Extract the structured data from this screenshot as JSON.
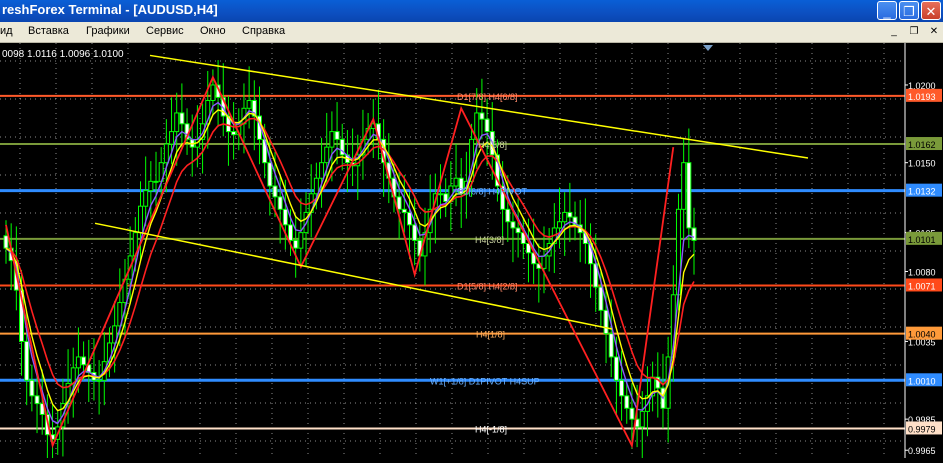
{
  "window": {
    "title": "reshForex Terminal - [AUDUSD,H4]",
    "btn_minimize": "_",
    "btn_restore": "❐",
    "btn_close": "✕"
  },
  "menu": {
    "items": [
      "ид",
      "Вставка",
      "Графики",
      "Сервис",
      "Окно",
      "Справка"
    ],
    "mdi_min": "_",
    "mdi_restore": "❐",
    "mdi_close": "✕"
  },
  "colors": {
    "background": "#000000",
    "grid": "#ffffff",
    "candle": "#00ff00",
    "yellow": "#ffff00",
    "red": "#ff2020",
    "purple": "#8a5cff",
    "blue": "#2f8cff"
  },
  "chart_data": {
    "type": "candlestick",
    "symbol": "AUDUSD",
    "timeframe": "H4",
    "ohlc_header": "0098 1.0116 1.0096 1.0100",
    "ylim": [
      0.996,
      1.0227
    ],
    "y_ticks": [
      "1.0200",
      "1.0150",
      "1.0105",
      "1.0080",
      "1.0035",
      "0.9985",
      "0.9965"
    ],
    "price_labels": [
      {
        "text": "1.0193",
        "value": 1.0193,
        "color": "#ff5a2a"
      },
      {
        "text": "1.0162",
        "value": 1.0162,
        "color": "#7a9a3a"
      },
      {
        "text": "1.0132",
        "value": 1.0132,
        "color": "#2f8cff"
      },
      {
        "text": "1.0101",
        "value": 1.0101,
        "color": "#7a9a3a"
      },
      {
        "text": "1.0071",
        "value": 1.0071,
        "color": "#ff4a1a"
      },
      {
        "text": "1.0040",
        "value": 1.004,
        "color": "#ff9a3a"
      },
      {
        "text": "1.0010",
        "value": 1.001,
        "color": "#2f8cff"
      },
      {
        "text": "0.9979",
        "value": 0.9979,
        "color": "#ffe0c8"
      }
    ],
    "murrey_labels": [
      {
        "text": "D1[7/8] H4[6/8]",
        "value": 1.0193
      },
      {
        "text": "H4[5/8]",
        "value": 1.0162
      },
      {
        "text": "D1[6/8] H4PIVOT",
        "value": 1.0132
      },
      {
        "text": "H4[3/8]",
        "value": 1.0101
      },
      {
        "text": "D1[5/8] H4[2/8]",
        "value": 1.0071
      },
      {
        "text": "H4[1/8]",
        "value": 1.004
      },
      {
        "text": "W1[+1/8] D1PIVOT H4SUP",
        "value": 1.001
      },
      {
        "text": "H4[-1/8]",
        "value": 0.9979
      }
    ],
    "closes": [
      1.0095,
      1.0087,
      1.0068,
      1.0035,
      1.001,
      1.0,
      0.9995,
      0.9988,
      0.9975,
      0.9972,
      0.998,
      0.9995,
      1.0008,
      1.0018,
      1.0025,
      1.002,
      1.0015,
      1.001,
      1.001,
      1.0022,
      1.0034,
      1.0045,
      1.006,
      1.0075,
      1.009,
      1.0105,
      1.0122,
      1.0132,
      1.0138,
      1.0138,
      1.015,
      1.0162,
      1.017,
      1.0182,
      1.0175,
      1.0165,
      1.016,
      1.0165,
      1.0175,
      1.019,
      1.02,
      1.0192,
      1.018,
      1.017,
      1.0168,
      1.0175,
      1.0185,
      1.019,
      1.018,
      1.0165,
      1.015,
      1.0135,
      1.0128,
      1.012,
      1.011,
      1.01,
      1.0095,
      1.0105,
      1.0118,
      1.013,
      1.014,
      1.015,
      1.016,
      1.017,
      1.0165,
      1.0155,
      1.015,
      1.0148,
      1.0155,
      1.0165,
      1.0172,
      1.0175,
      1.0165,
      1.015,
      1.014,
      1.0128,
      1.012,
      1.0118,
      1.011,
      1.01,
      1.009,
      1.0105,
      1.012,
      1.013,
      1.013,
      1.0125,
      1.0135,
      1.014,
      1.013,
      1.0138,
      1.0165,
      1.0182,
      1.0178,
      1.017,
      1.0155,
      1.0135,
      1.012,
      1.0112,
      1.0108,
      1.0105,
      1.0098,
      1.0092,
      1.0085,
      1.0082,
      1.009,
      1.0098,
      1.0108,
      1.0112,
      1.0118,
      1.0115,
      1.011,
      1.0105,
      1.0098,
      1.0085,
      1.007,
      1.0055,
      1.004,
      1.0025,
      1.001,
      1.0,
      0.9992,
      0.9985,
      0.998,
      0.999,
      1.0,
      1.0012,
      1.0005,
      0.9992,
      1.0025,
      1.0065,
      1.012,
      1.015,
      1.0108,
      1.01
    ]
  }
}
